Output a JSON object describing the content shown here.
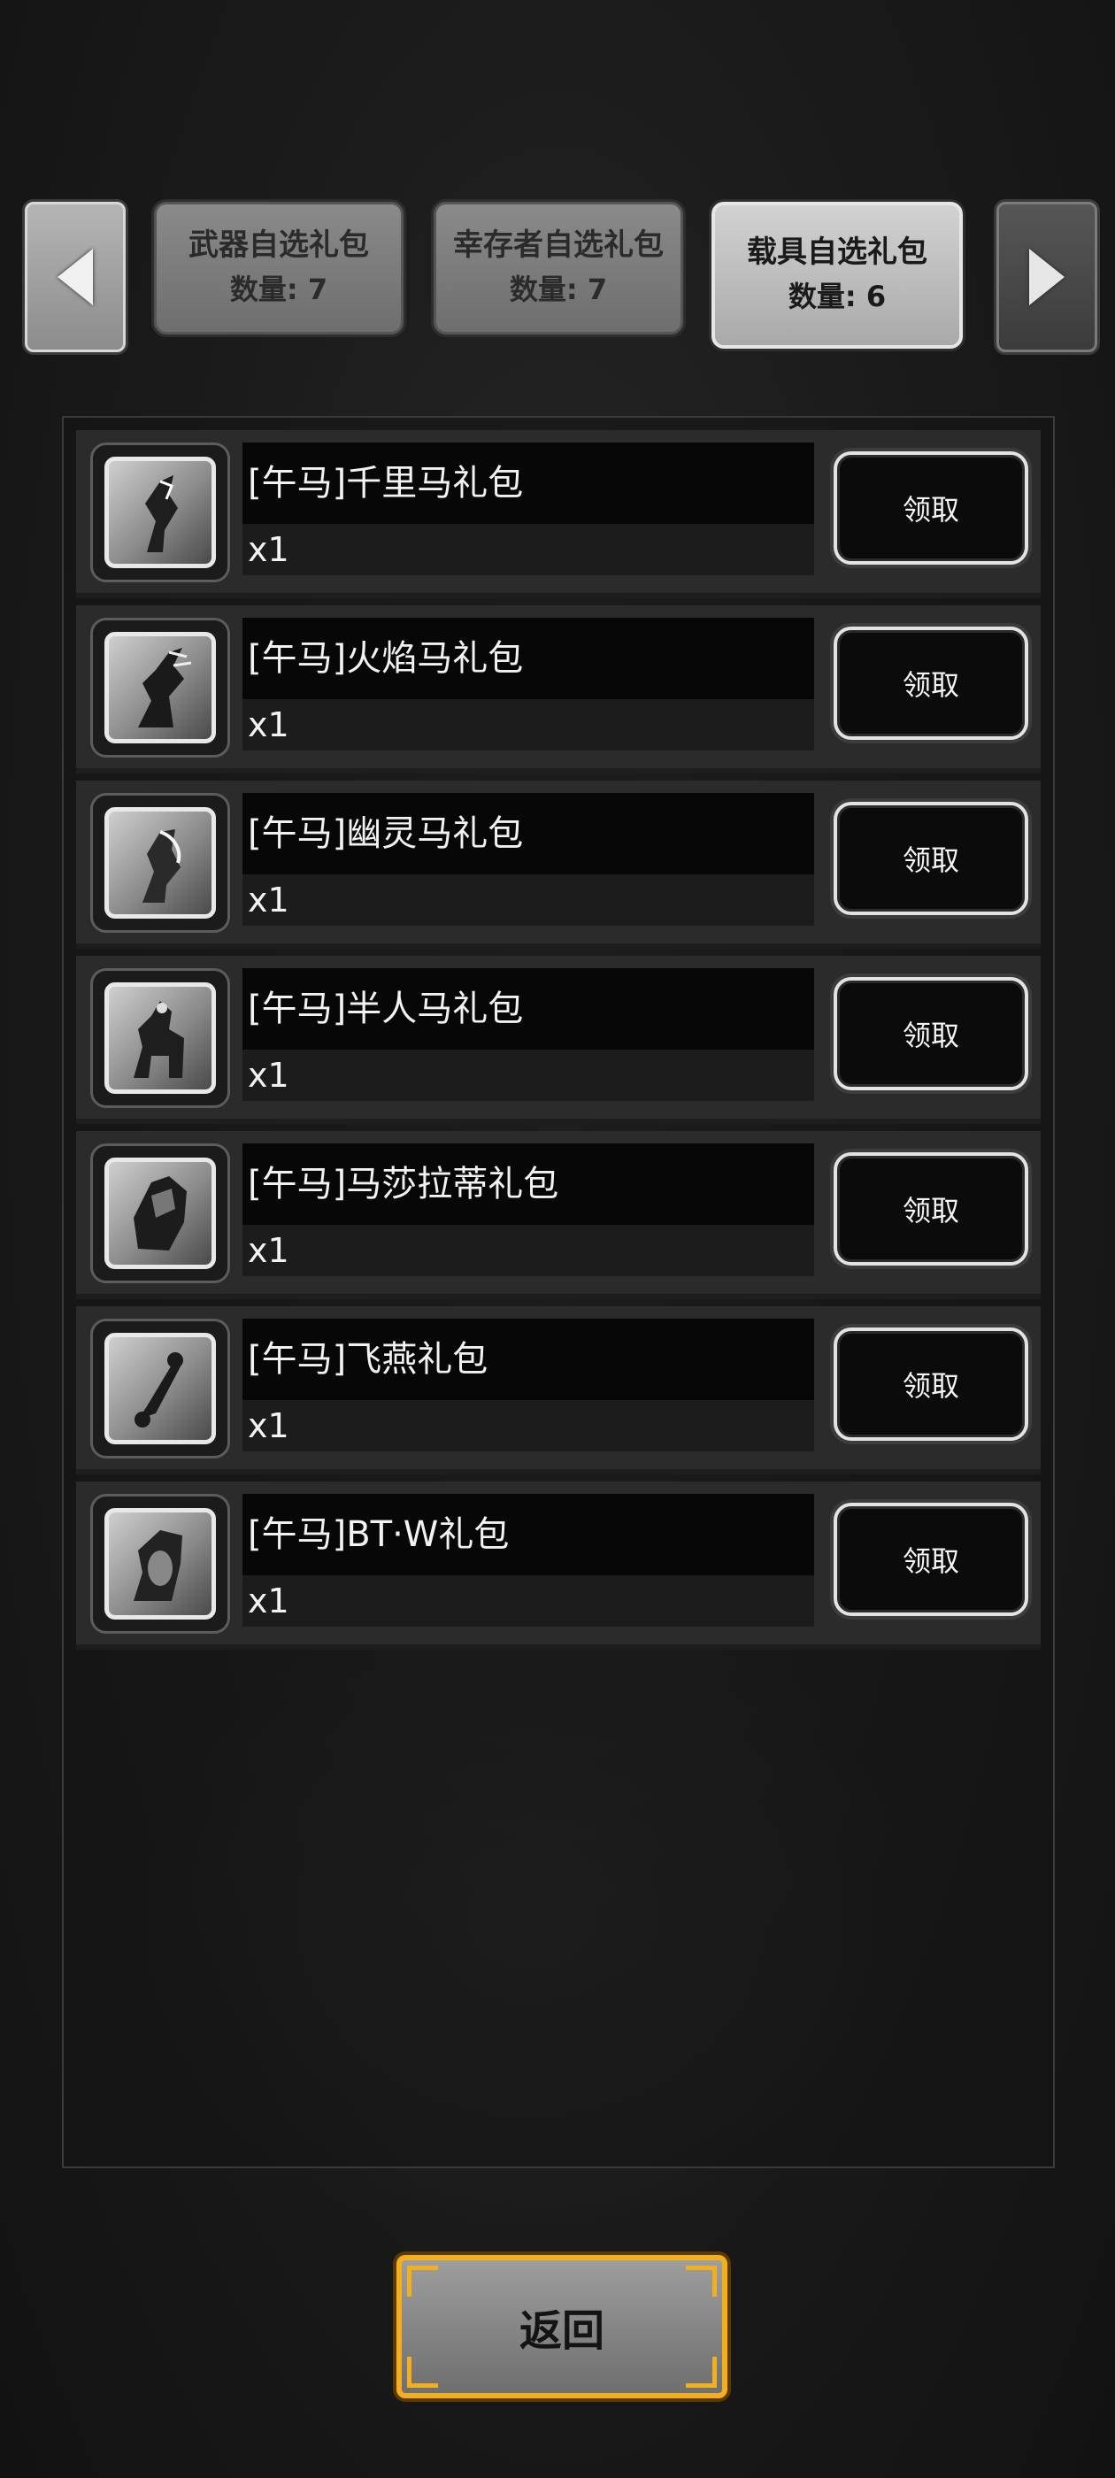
{
  "tabs": [
    {
      "title": "武器自选礼包",
      "count": "数量: 7",
      "active": false
    },
    {
      "title": "幸存者自选礼包",
      "count": "数量: 7",
      "active": false
    },
    {
      "title": "载具自选礼包",
      "count": "数量: 6",
      "active": true
    }
  ],
  "items": [
    {
      "name": "[午马]千里马礼包",
      "qty": "x1",
      "claim": "领取",
      "icon": "horse-creature-icon"
    },
    {
      "name": "[午马]火焰马礼包",
      "qty": "x1",
      "claim": "领取",
      "icon": "flame-horse-icon"
    },
    {
      "name": "[午马]幽灵马礼包",
      "qty": "x1",
      "claim": "领取",
      "icon": "ghost-horse-icon"
    },
    {
      "name": "[午马]半人马礼包",
      "qty": "x1",
      "claim": "领取",
      "icon": "centaur-icon"
    },
    {
      "name": "[午马]马莎拉蒂礼包",
      "qty": "x1",
      "claim": "领取",
      "icon": "sports-car-icon"
    },
    {
      "name": "[午马]飞燕礼包",
      "qty": "x1",
      "claim": "领取",
      "icon": "scooter-icon"
    },
    {
      "name": "[午马]BT·W礼包",
      "qty": "x1",
      "claim": "领取",
      "icon": "motorbike-icon"
    }
  ],
  "back_label": "返回"
}
